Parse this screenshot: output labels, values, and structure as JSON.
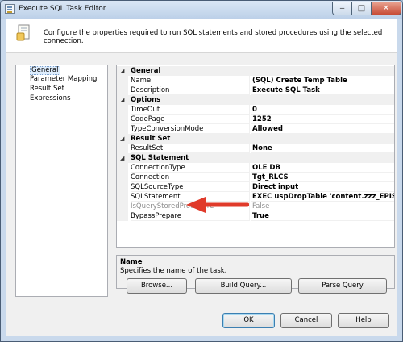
{
  "window": {
    "title": "Execute SQL Task Editor",
    "controls": {
      "minimize": "‒",
      "maximize": "□",
      "close": "✕"
    }
  },
  "banner": {
    "description": "Configure the properties required to run SQL statements and stored procedures using the selected connection.",
    "icon": "sql-task-icon"
  },
  "nav": {
    "items": [
      {
        "label": "General",
        "selected": true
      },
      {
        "label": "Parameter Mapping",
        "selected": false
      },
      {
        "label": "Result Set",
        "selected": false
      },
      {
        "label": "Expressions",
        "selected": false
      }
    ]
  },
  "grid": {
    "expander_glyph": "◢",
    "categories": [
      {
        "label": "General",
        "properties": [
          {
            "name": "Name",
            "value": "(SQL) Create Temp Table"
          },
          {
            "name": "Description",
            "value": "Execute SQL Task"
          }
        ]
      },
      {
        "label": "Options",
        "properties": [
          {
            "name": "TimeOut",
            "value": "0"
          },
          {
            "name": "CodePage",
            "value": "1252"
          },
          {
            "name": "TypeConversionMode",
            "value": "Allowed"
          }
        ]
      },
      {
        "label": "Result Set",
        "properties": [
          {
            "name": "ResultSet",
            "value": "None"
          }
        ]
      },
      {
        "label": "SQL Statement",
        "properties": [
          {
            "name": "ConnectionType",
            "value": "OLE DB"
          },
          {
            "name": "Connection",
            "value": "Tgt_RLCS"
          },
          {
            "name": "SQLSourceType",
            "value": "Direct input"
          },
          {
            "name": "SQLStatement",
            "value": "EXEC uspDropTable 'content.zzz_EPISODE' BEG"
          },
          {
            "name": "IsQueryStoredProcedure",
            "value": "False",
            "disabled": true
          },
          {
            "name": "BypassPrepare",
            "value": "True"
          }
        ]
      }
    ]
  },
  "description_panel": {
    "title": "Name",
    "text": "Specifies the name of the task."
  },
  "buttons": {
    "browse": "Browse...",
    "build_query": "Build Query...",
    "parse_query": "Parse Query",
    "ok": "OK",
    "cancel": "Cancel",
    "help": "Help"
  },
  "colors": {
    "annotation_arrow": "#e03a2a",
    "selection_bg": "#ddecfc"
  }
}
